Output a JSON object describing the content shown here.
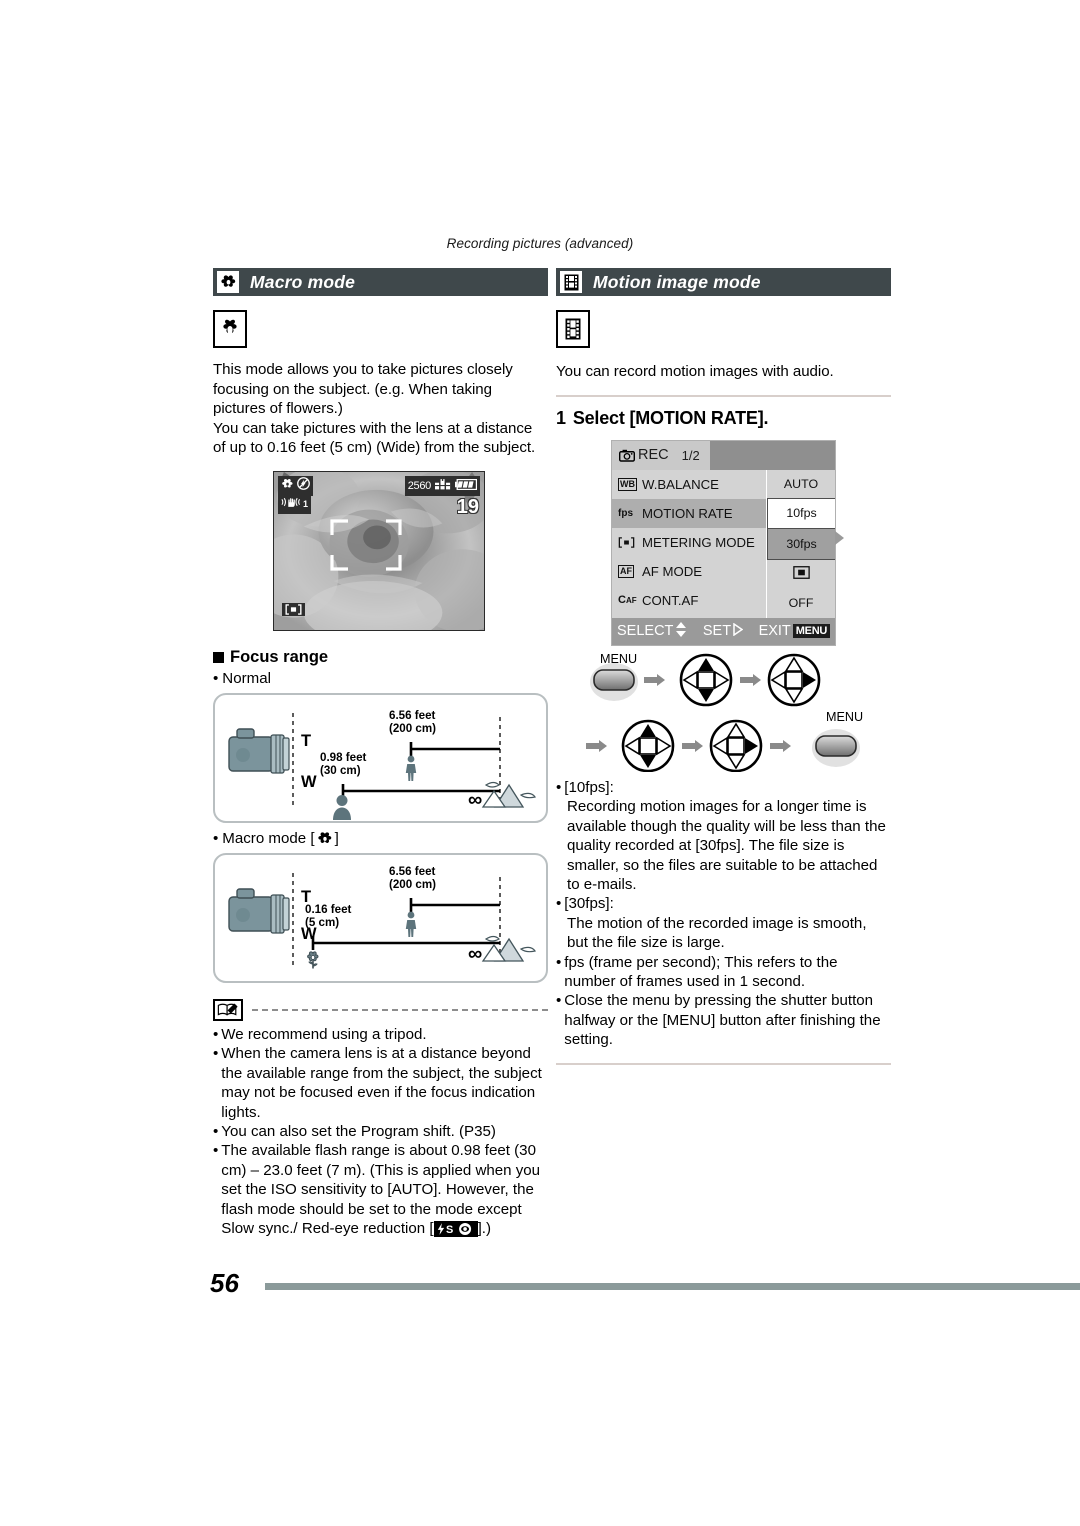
{
  "running_header": "Recording pictures (advanced)",
  "page_number": "56",
  "left": {
    "section": {
      "title": "Macro mode",
      "icon": "macro-flower-icon"
    },
    "mode_glyph_icon": "macro-flower-icon",
    "paragraphs": [
      "This mode allows you to take pictures closely focusing on the subject. (e.g. When taking pictures of flowers.)",
      "You can take pictures with the lens at a distance of up to 0.16 feet (5 cm) (Wide) from the subject."
    ],
    "lcd": {
      "macro_icon": "macro-flower-icon",
      "flash_icon": "flash-off-icon",
      "stabilizer_icon": "image-stabilizer-icon",
      "stabilizer_mode": "1",
      "resolution": "2560",
      "quality_icon": "fine-quality-icon",
      "battery_icon": "battery-full-icon",
      "shots_remaining": "19",
      "metering_icon": "spot-metering-icon",
      "af_frame_icon": "af-frame-icon"
    },
    "focus_range": {
      "heading": "Focus range",
      "normal": {
        "label": "Normal",
        "tele_letter": "T",
        "wide_letter": "W",
        "tele_near": "6.56 feet",
        "tele_near_cm": "(200 cm)",
        "wide_near": "0.98 feet",
        "wide_near_cm": "(30 cm)",
        "far_symbol": "∞"
      },
      "macro": {
        "label": "Macro mode [",
        "label_end": "]",
        "icon": "macro-flower-icon",
        "tele_letter": "T",
        "wide_letter": "W",
        "tele_near": "6.56 feet",
        "tele_near_cm": "(200 cm)",
        "wide_near": "0.16 feet",
        "wide_near_cm": "(5 cm)",
        "far_symbol": "∞"
      }
    },
    "notes_icon": "note-book-icon",
    "notes": [
      "We recommend using a tripod.",
      "When the camera lens is at a distance beyond the available range from the subject, the subject may not be focused even if the focus indication lights.",
      "You can also set the Program shift. (P35)"
    ],
    "note_flash": {
      "line1": "The available flash range is about",
      "line2": "0.98 feet (30 cm) – 23.0 feet (7 m). (This is applied when you set the ISO sensitivity to [AUTO]. However, the flash mode should be set to the mode except Slow sync./",
      "line3_pre": "Red-eye reduction [",
      "line3_post": "].)",
      "icon": "slow-sync-red-eye-icon"
    }
  },
  "right": {
    "section": {
      "title": "Motion image mode",
      "icon": "film-strip-icon"
    },
    "mode_glyph_icon": "film-strip-icon",
    "intro": "You can record motion images with audio.",
    "step": {
      "number": "1",
      "text": "Select [MOTION RATE]."
    },
    "menu": {
      "tab_label": "REC",
      "tab_icon": "camera-icon",
      "page_indicator": "1/2",
      "rows": [
        {
          "icon": "wb-icon",
          "icon_text": "WB",
          "label": "W.BALANCE",
          "value": "AUTO",
          "selected": false
        },
        {
          "icon": "fps-icon",
          "icon_text": "fps",
          "label": "MOTION RATE",
          "value": "10fps",
          "selected": true
        },
        {
          "icon": "metering-icon",
          "icon_text": "[·]",
          "label": "METERING MODE",
          "value": "30fps",
          "selected": false
        },
        {
          "icon": "af-icon",
          "icon_text": "AF",
          "label": "AF MODE",
          "value": "■",
          "selected": false
        },
        {
          "icon": "caf-icon",
          "icon_text": "CAF",
          "label": "CONT.AF",
          "value": "OFF",
          "selected": false
        }
      ],
      "footer": {
        "select": "SELECT",
        "set": "SET",
        "exit": "EXIT",
        "menu_key": "MENU"
      }
    },
    "nav": {
      "menu_label_start": "MENU",
      "menu_label_end": "MENU",
      "sequence": [
        "menu-button",
        "arrow",
        "dpad-updown",
        "arrow",
        "dpad-right",
        "arrow",
        "dpad-updown",
        "arrow",
        "dpad-right",
        "arrow",
        "menu-button"
      ]
    },
    "bullets": [
      {
        "head": "[10fps]:",
        "body": "Recording motion images for a longer time is available though the quality will be less than the quality recorded at [30fps]. The file size is smaller, so the files are suitable to be attached to e-mails."
      },
      {
        "head": "[30fps]:",
        "body": "The motion of the recorded image is smooth, but the file size is large."
      },
      {
        "head": "",
        "body": "fps (frame per second); This refers to the number of frames used in 1 second."
      },
      {
        "head": "",
        "body": "Close the menu by pressing the shutter button halfway or the [MENU] button after finishing the setting."
      }
    ]
  },
  "colors": {
    "header_bar": "#3f484b",
    "rule": "#d8cfcb",
    "footer_bar": "#8b9a9a",
    "range_box_border": "#b9bfc1",
    "camera_body": "#7b949c",
    "menu_bg": "#d3d3d3"
  }
}
